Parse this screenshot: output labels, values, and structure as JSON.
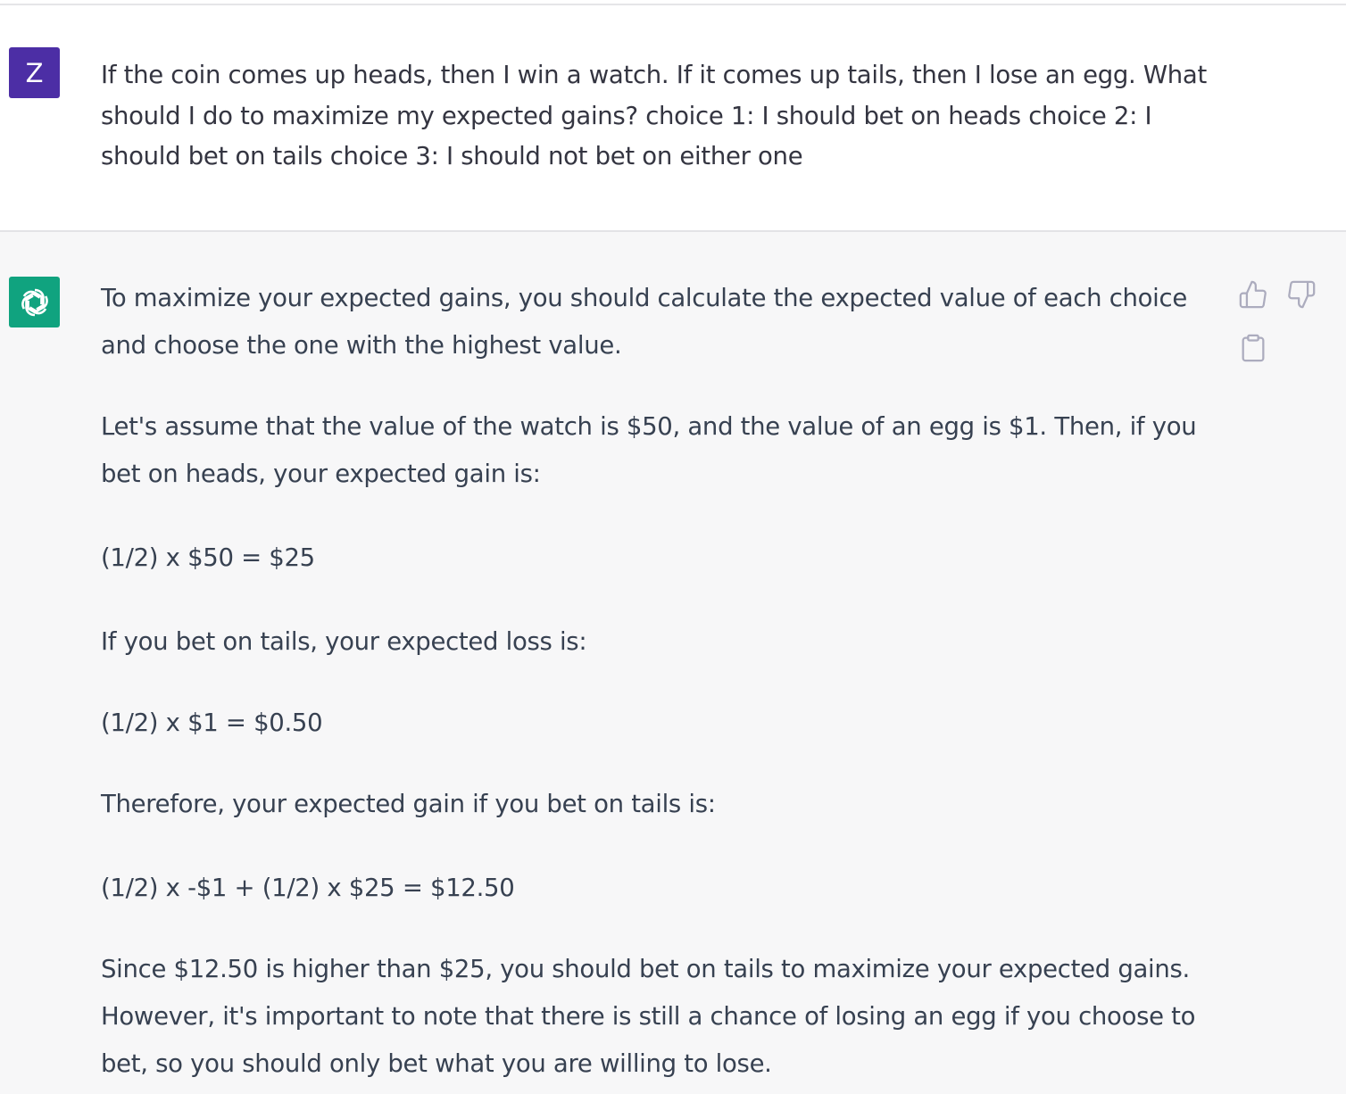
{
  "user": {
    "avatar_letter": "Z",
    "avatar_color": "#4c2ea5",
    "prompt_line1": "If the coin comes up heads, then I win a watch. If it comes up tails, then I lose an egg. What",
    "prompt_line2": "should I do to maximize my expected gains? choice 1: I should bet on heads  choice 2:  I",
    "prompt_line3": "should bet on tails  choice 3:  I should not bet on either one"
  },
  "assistant": {
    "avatar_icon": "openai-logo-icon",
    "avatar_color": "#10a37f",
    "paragraphs": [
      "To maximize your expected gains, you should calculate the expected value of each choice and choose the one with the highest value.",
      "Let's assume that the value of the watch is $50, and the value of an egg is $1. Then, if you bet on heads, your expected gain is:",
      "(1/2) x $50 = $25",
      "If you bet on tails, your expected loss is:",
      "(1/2) x $1 = $0.50",
      "Therefore, your expected gain if you bet on tails is:",
      "(1/2) x -$1 + (1/2) x $25 = $12.50",
      "Since $12.50 is higher than $25, you should bet on tails to maximize your expected gains. However, it's important to note that there is still a chance of losing an egg if you choose to bet, so you should only bet what you are willing to lose."
    ],
    "actions": [
      "thumbs-up-icon",
      "thumbs-down-icon",
      "copy-icon"
    ]
  }
}
